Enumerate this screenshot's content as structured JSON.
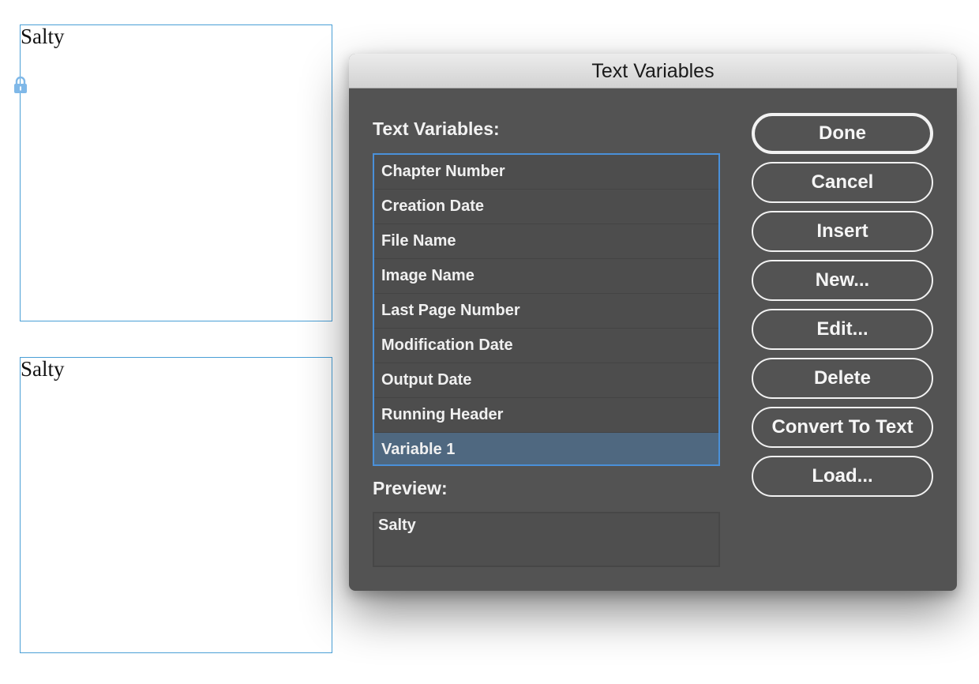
{
  "document": {
    "frame_top_text": "Salty",
    "frame_bottom_text": "Salty"
  },
  "dialog": {
    "title": "Text Variables",
    "list_label": "Text Variables:",
    "variables": [
      "Chapter Number",
      "Creation Date",
      "File Name",
      "Image Name",
      "Last Page Number",
      "Modification Date",
      "Output Date",
      "Running Header",
      "Variable 1"
    ],
    "selected_variable": "Variable 1",
    "preview_label": "Preview:",
    "preview_value": "Salty",
    "buttons": {
      "done": "Done",
      "cancel": "Cancel",
      "insert": "Insert",
      "new": "New...",
      "edit": "Edit...",
      "delete": "Delete",
      "convert": "Convert To Text",
      "load": "Load..."
    }
  },
  "colors": {
    "dialog_bg": "#535353",
    "selection": "#4f6880",
    "focus_ring": "#4a90d9",
    "frame_border": "#4a9fd6"
  }
}
